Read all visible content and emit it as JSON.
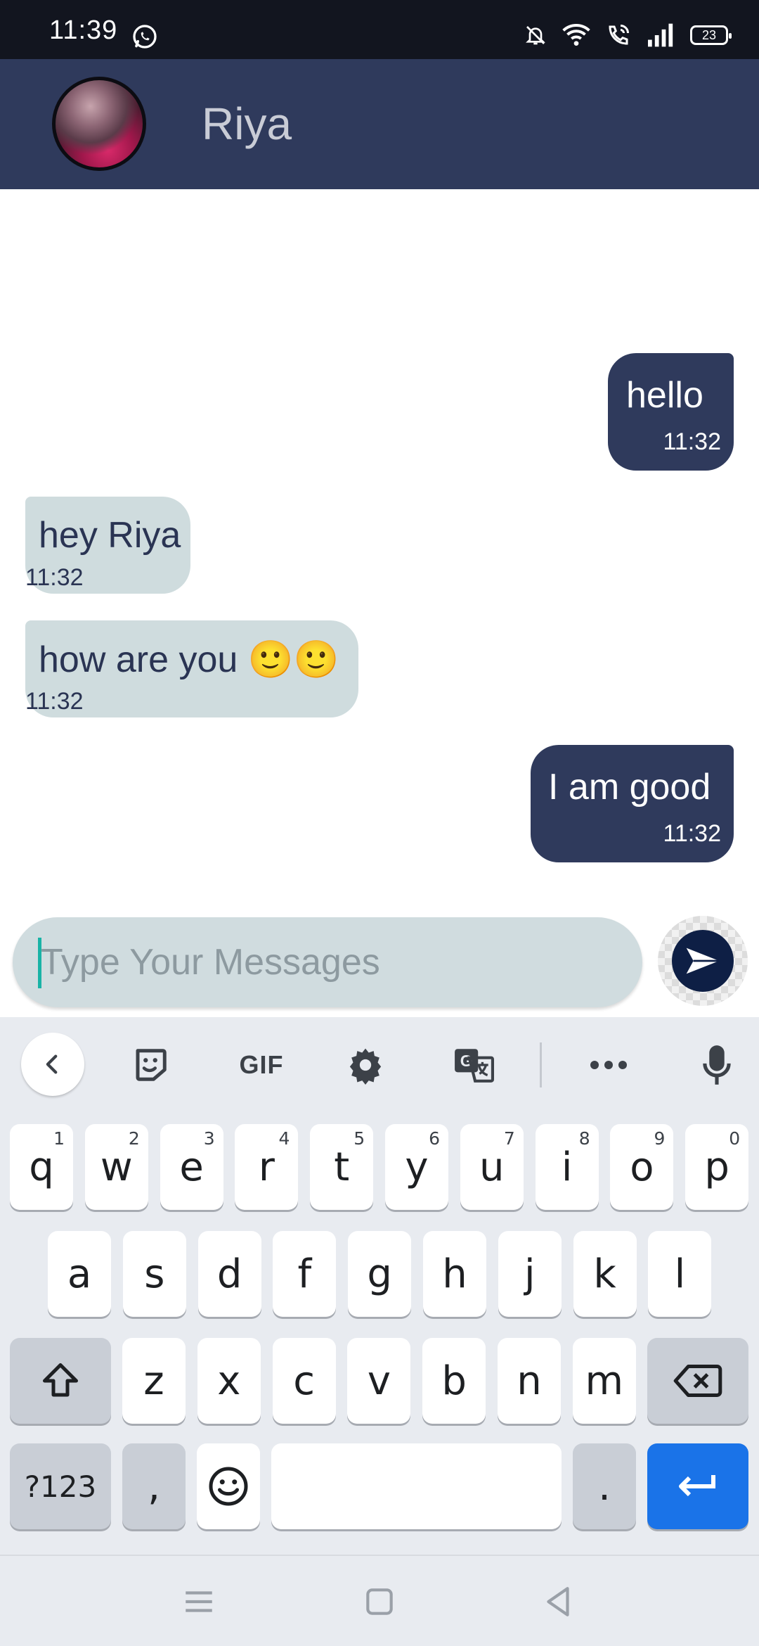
{
  "status_bar": {
    "time": "11:39",
    "battery": "23",
    "icons": [
      "whatsapp-icon",
      "bell-off-icon",
      "wifi-icon",
      "wifi-call-icon",
      "signal-icon",
      "battery-icon"
    ]
  },
  "header": {
    "contact_name": "Riya",
    "avatar_icon": "avatar"
  },
  "messages": [
    {
      "direction": "out",
      "text": "hello",
      "time": "11:32"
    },
    {
      "direction": "in",
      "text": "hey Riya",
      "time": "11:32"
    },
    {
      "direction": "in",
      "text": "how are you 🙂🙂",
      "time": "11:32"
    },
    {
      "direction": "out",
      "text": "I am good",
      "time": "11:32"
    }
  ],
  "composer": {
    "placeholder": "Type Your Messages",
    "value": "",
    "send_icon": "send-icon"
  },
  "keyboard": {
    "toolbar": {
      "back_icon": "chevron-left-icon",
      "sticker_icon": "sticker-icon",
      "gif_label": "GIF",
      "settings_icon": "gear-icon",
      "translate_icon": "translate-icon",
      "more_icon": "more-icon",
      "mic_icon": "mic-icon"
    },
    "row1": [
      {
        "k": "q",
        "h": "1"
      },
      {
        "k": "w",
        "h": "2"
      },
      {
        "k": "e",
        "h": "3"
      },
      {
        "k": "r",
        "h": "4"
      },
      {
        "k": "t",
        "h": "5"
      },
      {
        "k": "y",
        "h": "6"
      },
      {
        "k": "u",
        "h": "7"
      },
      {
        "k": "i",
        "h": "8"
      },
      {
        "k": "o",
        "h": "9"
      },
      {
        "k": "p",
        "h": "0"
      }
    ],
    "row2": [
      "a",
      "s",
      "d",
      "f",
      "g",
      "h",
      "j",
      "k",
      "l"
    ],
    "row3": [
      "z",
      "x",
      "c",
      "v",
      "b",
      "n",
      "m"
    ],
    "row4": {
      "symbols": "?123",
      "comma": ",",
      "period": "."
    }
  },
  "colors": {
    "header": "#2f3a5c",
    "outgoing_bubble": "#2f3a5c",
    "incoming_bubble": "#cfdcde",
    "enter_key": "#1a73e8"
  }
}
